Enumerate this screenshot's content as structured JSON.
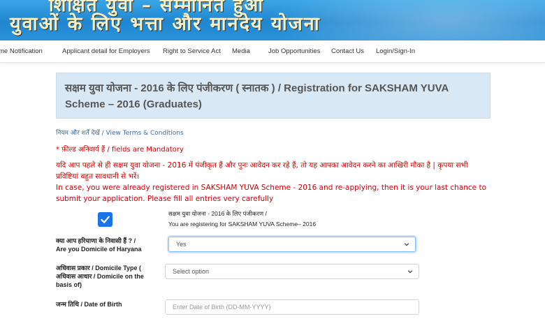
{
  "banner": {
    "line1": "शिक्षित युवा – सम्मानित हुआ",
    "line2": "युवाओं के लिए भत्ता और मानदेय योजना"
  },
  "nav": {
    "items": [
      "me Notification",
      "Applicant detail for Employers",
      "Right to Service Act",
      "Media",
      "Job Opportunities",
      "Contact Us",
      "Login/Sign-In"
    ]
  },
  "form": {
    "title": "सक्षम युवा योजना - 2016 के लिए पंजीकरण ( स्नातक ) / Registration for SAKSHAM YUVA Scheme – 2016 (Graduates)",
    "terms_link": "नियम और शर्तें देखें / View Terms & Conditions",
    "mandatory_note": "* फ़ील्ड अनिवार्य हैं / fields are Mandatory",
    "notice_hindi": "यदि आप पहले से ही सक्षम युवा योजना - 2016 में पंजीकृत हैं और पुनः आवेदन कर रहे हैं, तो यह आपका आवेदन करने का आखिरी मौका है | कृपया सभी प्रविष्टियां बहुत सावधानी से भरें।",
    "notice_english": "In case, you were already registered in SAKSHAM YUVA Scheme - 2016 and re-applying, then it is your last chance to submit your application. Please fill all entries very carefully",
    "scheme_check": {
      "checked": true,
      "label_hindi": "सक्षम युवा योजना - 2016 के लिए पंजीकरण /",
      "label_english": "You are registering for SAKSHAM YUVA Scheme– 2016"
    },
    "domicile": {
      "label_hindi": "क्या आप हरियाणा के निवासी हैं ? /",
      "label_english": "Are you Domicile of Haryana",
      "value": "Yes"
    },
    "domicile_type": {
      "label_hindi": "अधिवास प्रकार / Domicile Type (",
      "label_line2": "अधिवास आधार / Domicile on the",
      "label_line3": "basis of)",
      "value": "Select option"
    },
    "dob": {
      "label": "जन्म तिथि / Date of Birth",
      "placeholder": "Enter Date of Birth (DD-MM-YYYY)"
    }
  },
  "colors": {
    "banner_blue": "#1f86cf",
    "title_bg": "#d8e8f5",
    "alert_red": "#d40000",
    "checkbox_blue": "#1a73e8"
  }
}
